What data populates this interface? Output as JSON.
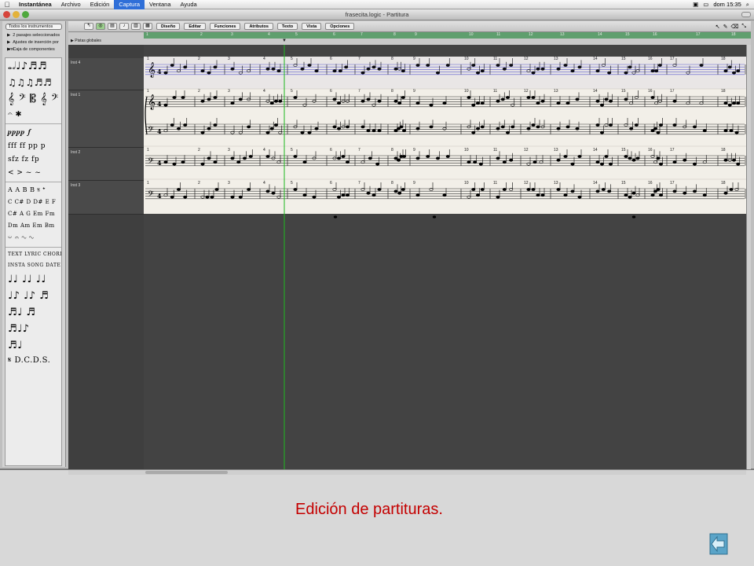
{
  "menubar": {
    "apple": "",
    "items": [
      "Instantánea",
      "Archivo",
      "Edición",
      "Captura",
      "Ventana",
      "Ayuda"
    ],
    "active_index": 3,
    "clock": "dom 15:35"
  },
  "window": {
    "title": "frasecita.logic - Partitura"
  },
  "left_panel": {
    "instrument_select": "Todos los instrumentos",
    "items": [
      "2 pasajes seleccionados",
      "Ajustes de inserción por omi",
      "Caja de componentes"
    ],
    "palette_rows": [
      "𝅝𝅗𝅥♩♪♬♬",
      "♫♫♫♬♬",
      "𝄞 𝄢 𝄡 𝄞 𝄢",
      "𝄐 ✱ ",
      "𝆏𝆏𝆏𝆏 𝆑",
      "fff ff pp p",
      "sfz fz fp",
      "< > ~ ~",
      "A A B B 𝄋 𝄌",
      "C C# D D# E F",
      "C# A G Em Fm",
      "Dm Am Em Bm",
      "𝄑 𝄐 ∿ ∿",
      "TEXT LYRIC CHORD REGION",
      "INSTA SONG DATE",
      "♩♩ ♩♩ ♩♩",
      "♩♪ ♩♪ ♬",
      "♬♩ ♬",
      "♬♩♪",
      "♬♩",
      "𝄋 D.C.D.S."
    ]
  },
  "toolbar": {
    "menus": [
      "Diseño",
      "Editar",
      "Funciones",
      "Atributos",
      "Texto",
      "Vista",
      "Opciones"
    ]
  },
  "ruler": {
    "global_tracks_label": "Pistas globales",
    "bars": [
      "1",
      "2",
      "3",
      "4",
      "5",
      "6",
      "7",
      "8",
      "9",
      "10",
      "11",
      "12",
      "13",
      "14",
      "15",
      "16",
      "17",
      "18"
    ]
  },
  "tracks": [
    {
      "name": "Inst 4"
    },
    {
      "name": "Inst 1"
    },
    {
      "name": "Inst 2"
    },
    {
      "name": "Inst 3"
    }
  ],
  "score": {
    "bar_numbers": [
      "1",
      "2",
      "3",
      "4",
      "5",
      "6",
      "7",
      "8",
      "9",
      "10",
      "11",
      "12",
      "13",
      "14",
      "15",
      "16",
      "17",
      "18"
    ],
    "playhead_bar": 4.5
  },
  "caption": "Edición de partituras.",
  "colors": {
    "caption": "#c40000",
    "ruler": "#5f9f6e",
    "playhead": "#1fb81f",
    "score_paper": "#f2efe8"
  }
}
